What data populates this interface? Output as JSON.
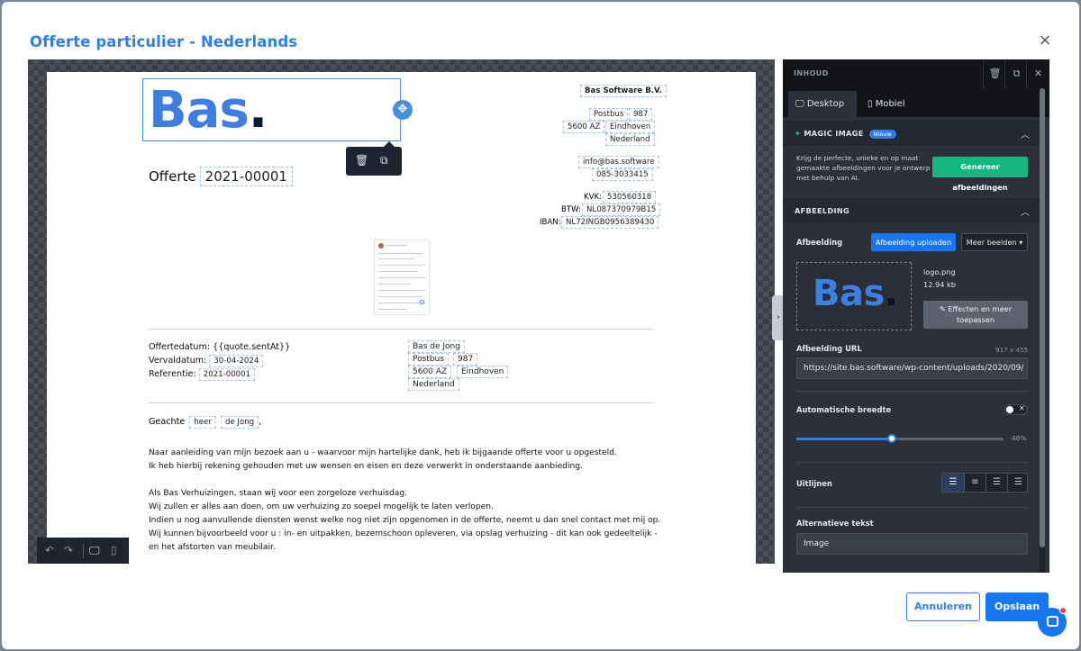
{
  "modal": {
    "title": "Offerte particulier - Nederlands",
    "close_icon": "×"
  },
  "document": {
    "logo_text": "Bas",
    "logo_dot": ".",
    "title": "Offerte",
    "quote_number": "2021-00001",
    "company": {
      "name": "Bas Software B.V.",
      "postbus_label": "Postbus",
      "postbus_number": "987",
      "postcode": "5600 AZ",
      "city": "Eindhoven",
      "country": "Nederland",
      "email": "info@bas.software",
      "phone": "085-3033415",
      "kvk_label": "KVK:",
      "kvk_value": "530560318",
      "btw_label": "BTW:",
      "btw_value": "NL087370979B15",
      "iban_label": "IBAN:",
      "iban_value": "NL72INGB0956389430"
    },
    "meta": {
      "offertedatum_label": "Offertedatum:",
      "offertedatum_value": "{{quote.sentAt}}",
      "vervaldatum_label": "Vervaldatum:",
      "vervaldatum_value": "30-04-2024",
      "referentie_label": "Referentie:",
      "referentie_value": "2021-00001"
    },
    "recipient": {
      "name": "Bas de Jong",
      "postbus_label": "Postbus",
      "postbus_number": "987",
      "postcode": "5600 AZ",
      "city": "Eindhoven",
      "country": "Nederland"
    },
    "greeting": {
      "word": "Geachte",
      "title": "heer",
      "lastname": "de Jong",
      "comma": ","
    },
    "paragraphs": [
      [
        "Naar aanleiding van mijn bezoek aan u - waarvoor mijn hartelijke dank, heb ik bijgaande offerte voor u opgesteld.",
        "Ik heb hierbij rekening gehouden met uw wensen en eisen en deze verwerkt in onderstaande aanbieding."
      ],
      [
        "Als Bas Verhuizingen, staan wij voor een zorgeloze verhuisdag.",
        "Wij zullen er alles aan doen, om uw verhuizing zo soepel mogelijk te laten verlopen.",
        "Indien u nog aanvullende diensten wenst welke nog niet zijn opgenomen in de offerte, neemt u dan snel contact met mij op.",
        "Wij kunnen bijvoorbeeld voor u : in- en uitpakken, bezemschoon opleveren, via opslag verhuizing - dit kan ook gedeeltelijk -",
        "en het afstorten van meubilair."
      ]
    ]
  },
  "panel": {
    "header_title": "INHOUD",
    "tabs": {
      "desktop": "Desktop",
      "mobile": "Mobiel"
    },
    "magic": {
      "title": "MAGIC IMAGE",
      "badge": "Nieuw",
      "description": "Krijg de perfecte, unieke en op maat gemaakte afbeeldingen voor je ontwerp met behulp van AI.",
      "button": "Genereer afbeeldingen"
    },
    "image_section": {
      "title": "AFBEELDING",
      "label": "Afbeelding",
      "upload_button": "Afbeelding uploaden",
      "more_button": "Meer beelden ▾",
      "file_name": "logo.png",
      "file_size": "12.94 kb",
      "effects_button": "Effecten en meer toepassen",
      "url_label": "Afbeelding URL",
      "dimensions": "917 x 455",
      "url_value": "https://site.bas.software/wp-content/uploads/2020/09/",
      "auto_width_label": "Automatische breedte",
      "width_percent": 46,
      "width_label": "46%",
      "align_label": "Uitlijnen",
      "alt_label": "Alternatieve tekst",
      "alt_value": "Image"
    }
  },
  "footer": {
    "cancel": "Annuleren",
    "save": "Opslaan"
  }
}
